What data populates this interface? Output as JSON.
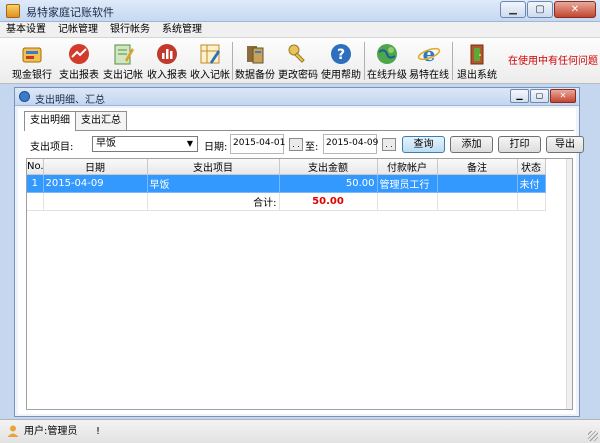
{
  "window": {
    "title": "易特家庭记账软件"
  },
  "menu": [
    "基本设置",
    "记帐管理",
    "银行帐务",
    "系统管理"
  ],
  "toolbar": {
    "items": [
      {
        "label": "现金银行",
        "icon": "cash-bank-icon",
        "color": "#e8a33a"
      },
      {
        "label": "支出报表",
        "icon": "expense-report-icon",
        "color": "#d23a2c"
      },
      {
        "label": "支出记帐",
        "icon": "expense-entry-icon",
        "color": "#6aa84f"
      },
      {
        "label": "收入报表",
        "icon": "income-report-icon",
        "color": "#c0392b"
      },
      {
        "label": "收入记帐",
        "icon": "income-entry-icon",
        "color": "#e59a3c"
      },
      {
        "label": "数据备份",
        "icon": "backup-icon",
        "color": "#8a6d3b"
      },
      {
        "label": "更改密码",
        "icon": "key-icon",
        "color": "#d4a93a"
      },
      {
        "label": "使用帮助",
        "icon": "help-icon",
        "color": "#2c6fbf"
      },
      {
        "label": "在线升级",
        "icon": "globe-icon",
        "color": "#3b8a3b"
      },
      {
        "label": "易特在线",
        "icon": "ie-icon",
        "color": "#2a79c9"
      },
      {
        "label": "退出系统",
        "icon": "exit-icon",
        "color": "#c0392b"
      }
    ],
    "note": "在使用中有任何问题"
  },
  "child": {
    "title": "支出明细、汇总",
    "tabs": [
      "支出明细",
      "支出汇总"
    ],
    "filters": {
      "item_label": "支出项目:",
      "item_value": "早饭",
      "date_label": "日期:",
      "date_from": "2015-04-01",
      "to_label": "至:",
      "date_to": "2015-04-09",
      "date_btn": ". .",
      "buttons": [
        "查询",
        "添加",
        "打印",
        "导出"
      ]
    },
    "table": {
      "headers": [
        "No.",
        "日期",
        "支出项目",
        "支出金额",
        "付款帐户",
        "备注",
        "状态"
      ],
      "rows": [
        {
          "no": "1",
          "date": "2015-04-09",
          "item": "早饭",
          "amount": "50.00",
          "account": "管理员工行",
          "note": "",
          "status": "未付"
        }
      ],
      "total_label": "合计:",
      "total_value": "50.00"
    }
  },
  "status": {
    "user": "用户:管理员",
    "mark": "!"
  }
}
